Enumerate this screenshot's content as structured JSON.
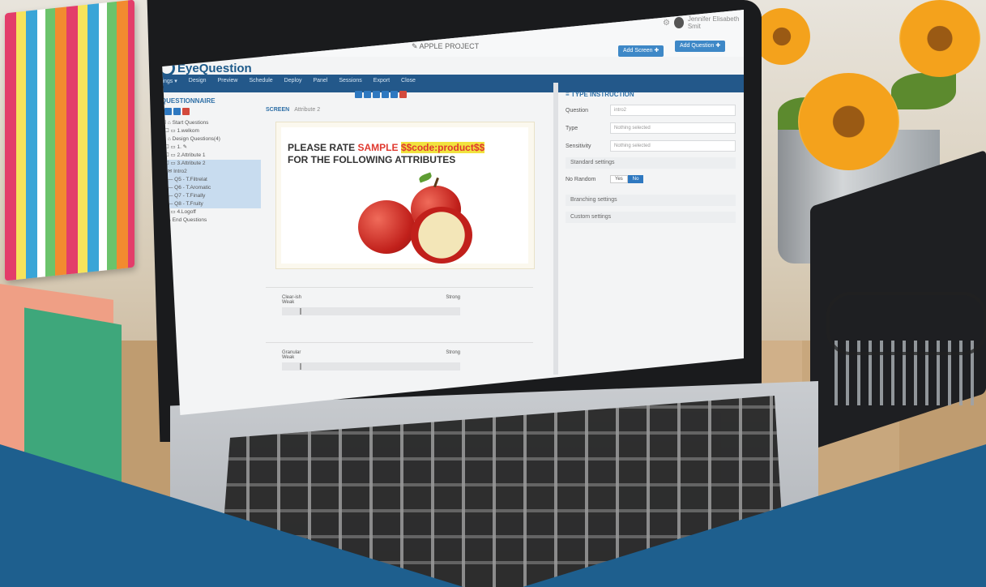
{
  "app": {
    "logo_text": "EyeQuestion",
    "project_title": "APPLE PROJECT",
    "user_name": "Jennifer Elisabeth Smit",
    "add_screen_label": "Add Screen ✚",
    "add_question_label": "Add Question ✚"
  },
  "nav": {
    "items": [
      "Settings ▾",
      "Design",
      "Preview",
      "Schedule",
      "Deploy",
      "Panel",
      "Sessions",
      "Export",
      "Close"
    ]
  },
  "questionnaire": {
    "title": "QUESTIONNAIRE",
    "tree": [
      {
        "label": "Start Questions",
        "selected": false
      },
      {
        "label": "1.welkom",
        "selected": false
      },
      {
        "label": "Design Questions(4)",
        "selected": false
      },
      {
        "label": "1.",
        "selected": false
      },
      {
        "label": "2.Attribute 1",
        "selected": false
      },
      {
        "label": "3.Attribute 2",
        "selected": true
      },
      {
        "label": "Intro2",
        "selected": true
      },
      {
        "label": "Q5 - T.Filtrelat",
        "selected": true
      },
      {
        "label": "Q6 - T.Aromatic",
        "selected": true
      },
      {
        "label": "Q7 - T.Finally",
        "selected": true
      },
      {
        "label": "Q8 - T.Fruity",
        "selected": true
      },
      {
        "label": "4.Logoff",
        "selected": false
      },
      {
        "label": "End Questions",
        "selected": false
      }
    ]
  },
  "screen": {
    "tab_label": "SCREEN",
    "tab_sub": "Attribute 2",
    "question_line1_a": "PLEASE RATE ",
    "question_line1_b": "SAMPLE ",
    "question_line1_code": "$$code:product$$",
    "question_line2": "FOR THE FOLLOWING ATTRIBUTES",
    "scales": [
      {
        "name": "Clear-ish",
        "low": "Weak",
        "high": "Strong"
      },
      {
        "name": "Granular",
        "low": "Weak",
        "high": "Strong"
      }
    ]
  },
  "type_instruction": {
    "title": "TYPE INSTRUCTION",
    "question_label": "Question",
    "question_value": "intro2",
    "type_label": "Type",
    "type_value": "Nothing selected",
    "sensitivity_label": "Sensitivity",
    "sensitivity_value": "Nothing selected",
    "standard_settings": "Standard settings",
    "no_random_label": "No Random",
    "toggle_yes": "Yes",
    "toggle_no": "No",
    "branching_settings": "Branching settings",
    "custom_settings": "Custom settings"
  }
}
